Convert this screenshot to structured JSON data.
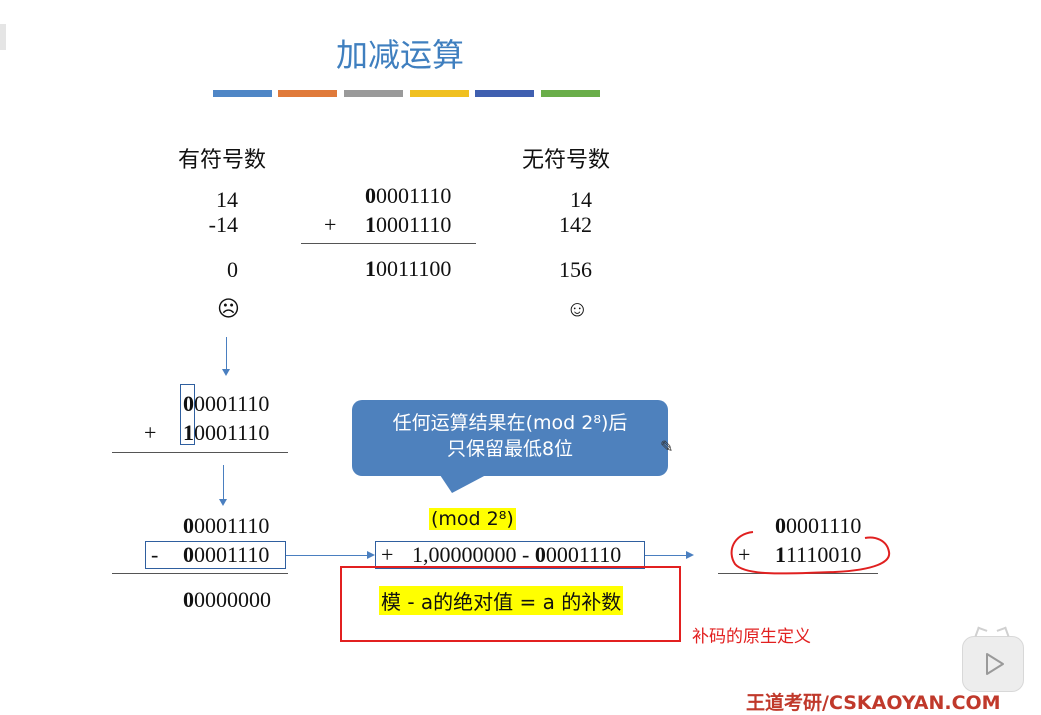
{
  "slide": {
    "title": "加减运算",
    "accent_colors": [
      "#4f86c6",
      "#e07a3a",
      "#9a9a9a",
      "#f0c020",
      "#3f5fb0",
      "#6aae4a"
    ],
    "signed_header": "有符号数",
    "unsigned_header": "无符号数",
    "signed": {
      "a": "14",
      "b": "-14",
      "result": "0",
      "face": "☹"
    },
    "unsigned": {
      "a": "14",
      "b": "142",
      "result": "156",
      "face": "☺"
    },
    "binary_top": {
      "a_first": "0",
      "a_rest": "0001110",
      "plus": "+",
      "b_first": "1",
      "b_rest": "0001110",
      "r_first": "1",
      "r_rest": "0011100"
    },
    "binary_mid": {
      "plus": "+",
      "a_first": "0",
      "a_rest": "0001110",
      "b_first": "1",
      "b_rest": "0001110"
    },
    "bubble": {
      "line1": "任何运算结果在(mod 2⁸)后",
      "line2": "只保留最低8位"
    },
    "binary_low": {
      "minus": "-",
      "a_first": "0",
      "a_rest": "0001110",
      "b_first": "0",
      "b_rest": "0001110",
      "r_first": "0",
      "r_rest": "0000000"
    },
    "mod_label": "(mod 2⁸)",
    "middle_expr": {
      "plus": "+",
      "part1": "1,00000000 - ",
      "part2_first": "0",
      "part2_rest": "0001110"
    },
    "right_calc": {
      "a_first": "0",
      "a_rest": "0001110",
      "plus": "+",
      "b_first": "1",
      "b_rest": "1110010"
    },
    "formula": "模 - a的绝对值 = a 的补数",
    "note": "补码的原生定义",
    "footer": "王道考研/CSKAOYAN.COM"
  }
}
